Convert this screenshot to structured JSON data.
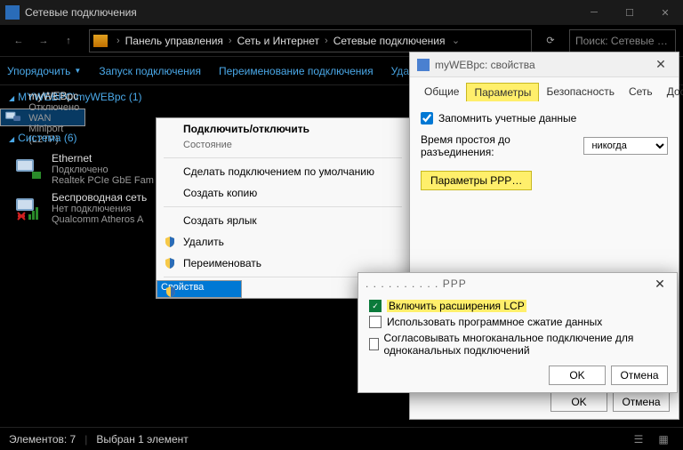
{
  "window": {
    "title": "Сетевые подключения"
  },
  "breadcrumb": {
    "seg1": "Панель управления",
    "seg2": "Сеть и Интернет",
    "seg3": "Сетевые подключения",
    "search_placeholder": "Поиск: Сетевые …"
  },
  "cmdbar": {
    "organize": "Упорядочить",
    "start": "Запуск подключения",
    "rename": "Переименование подключения",
    "delete": "Удален"
  },
  "group1": {
    "title": "MYWEBPC\\myWEBpc (1)",
    "item": {
      "name": "myWEBpc",
      "state": "Отключено",
      "device": "WAN Miniport (L2TP)"
    }
  },
  "group2": {
    "title": "Система (6)",
    "item1": {
      "name": "Ethernet",
      "state": "Подключено",
      "device": "Realtek PCIe GbE Fam"
    },
    "item2": {
      "name": "Беспроводная сеть",
      "state": "Нет подключения",
      "device": "Qualcomm Atheros A"
    }
  },
  "ctx": {
    "connect": "Подключить/отключить",
    "status": "Состояние",
    "default": "Сделать подключением по умолчанию",
    "copy": "Создать копию",
    "shortcut": "Создать ярлык",
    "delete": "Удалить",
    "rename": "Переименовать",
    "props": "Свойства"
  },
  "dlg1": {
    "title": "myWEBpc: свойства",
    "tab_general": "Общие",
    "tab_params": "Параметры",
    "tab_security": "Безопасность",
    "tab_network": "Сеть",
    "tab_access": "Доступ",
    "remember": "Запомнить учетные данные",
    "idle_label": "Время простоя до разъединения:",
    "idle_value": "никогда",
    "ppp_btn": "Параметры PPP…",
    "ok": "OK",
    "cancel": "Отмена"
  },
  "dlg2": {
    "title_suffix": "PPP",
    "lcp": "Включить расширения LCP",
    "compress": "Использовать программное сжатие данных",
    "multilink": "Согласовывать многоканальное подключение для одноканальных подключений",
    "ok": "OK",
    "cancel": "Отмена"
  },
  "status": {
    "elements": "Элементов: 7",
    "selected": "Выбран 1 элемент"
  }
}
